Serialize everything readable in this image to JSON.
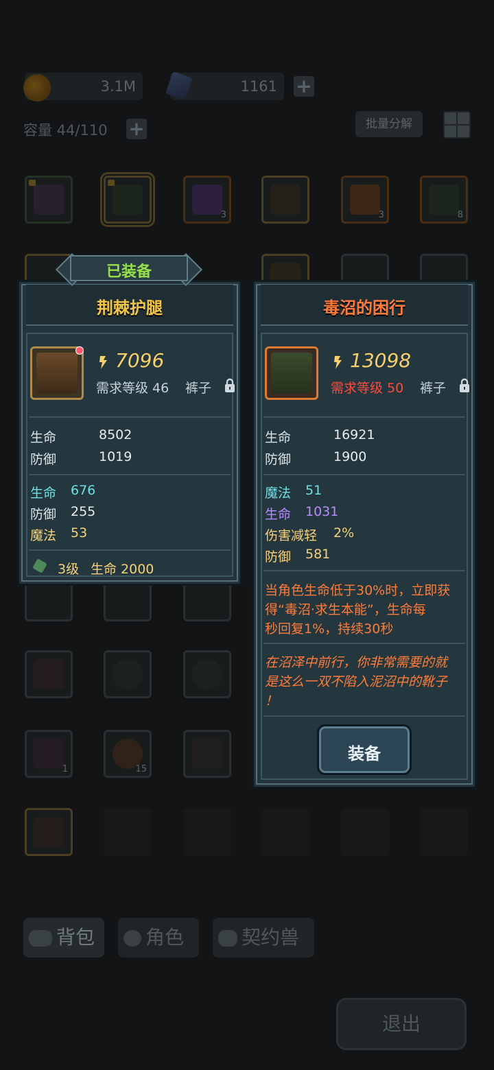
{
  "currency": {
    "gold": "3.1M",
    "gems": "1161"
  },
  "inventory": {
    "capacity": "容量 44/110",
    "batch_label": "批量分解"
  },
  "grid_counts": {
    "purple_stone": "3",
    "fire_egg": "3",
    "green_orb": "8",
    "collar": "1",
    "meat": "15"
  },
  "tabs": {
    "bag": "背包",
    "character": "角色",
    "pet": "契约兽"
  },
  "exit_label": "退出",
  "equipped_tag": "已装备",
  "left_card": {
    "title": "荆棘护腿",
    "power": "7096",
    "req_level": "需求等级 46",
    "type": "裤子",
    "base_stats": [
      {
        "label": "生命",
        "value": "8502"
      },
      {
        "label": "防御",
        "value": "1019"
      }
    ],
    "extra_stats": [
      {
        "label": "生命",
        "value": "676"
      },
      {
        "label": "防御",
        "value": "255"
      },
      {
        "label": "魔法",
        "value": "53"
      }
    ],
    "gem": {
      "level": "3级",
      "effect": "生命 2000"
    }
  },
  "right_card": {
    "title": "毒沼的困行",
    "power": "13098",
    "req_level": "需求等级 50",
    "type": "裤子",
    "base_stats": [
      {
        "label": "生命",
        "value": "16921"
      },
      {
        "label": "防御",
        "value": "1900"
      }
    ],
    "extra_stats": [
      {
        "label": "魔法",
        "value": "51"
      },
      {
        "label": "生命",
        "value": "1031"
      },
      {
        "label": "伤害减轻",
        "value": "2%"
      },
      {
        "label": "防御",
        "value": "581"
      }
    ],
    "skill_lines": [
      "当角色生命低于30%时，立即获",
      "得“毒沼·求生本能”，生命每",
      "秒回复1%，持续30秒"
    ],
    "flavor_lines": [
      "在沼泽中前行，你非常需要的就",
      "是这么一双不陷入泥沼中的靴子",
      "！"
    ],
    "equip_label": "装备"
  },
  "colors": {
    "title_gold": "#f2c44a",
    "title_orange": "#ff7a3c",
    "cyan": "#6fe0e4",
    "purple": "#b78cff",
    "yellow": "#f7d27a",
    "red": "#ff4a3d",
    "equipped_green": "#97e04a"
  }
}
